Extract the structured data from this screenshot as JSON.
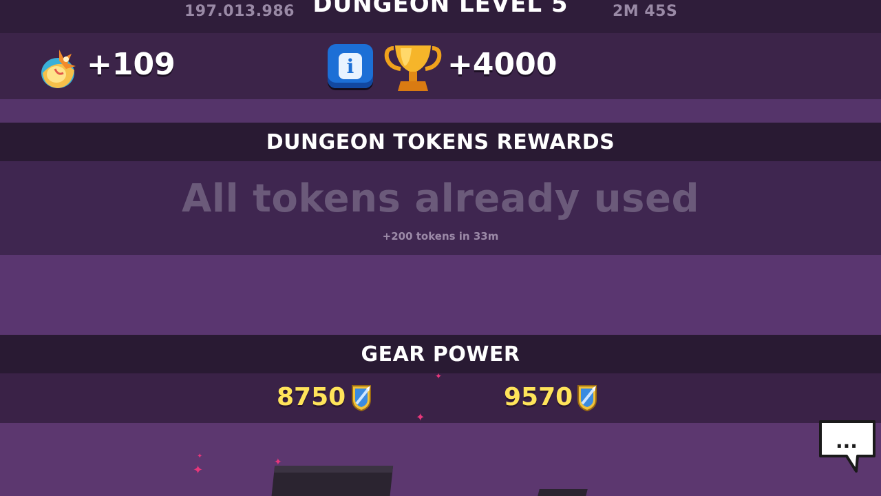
{
  "header": {
    "left_stat": "197.013.986",
    "title": "DUNGEON LEVEL 5",
    "right_stat": "2M 45S"
  },
  "rewards": {
    "left_value": "+109",
    "left_icon": "egg-icon",
    "info_icon": "info-icon",
    "info_glyph": "i",
    "trophy_icon": "trophy-icon",
    "right_value": "+4000"
  },
  "tokens": {
    "header": "DUNGEON TOKENS REWARDS",
    "message": "All tokens already used",
    "sub": "+200 tokens in 33m"
  },
  "gear": {
    "header": "GEAR POWER",
    "left_value": "8750",
    "right_value": "9570",
    "icon": "gear-power-icon"
  },
  "chat": {
    "icon": "chat-bubble-icon",
    "glyph": "..."
  },
  "colors": {
    "background": "#4a2c5a",
    "header_band": "#291a33",
    "gear_value": "#ffe45a",
    "info_button": "#1c6fd6",
    "sparkle": "#e8377b"
  }
}
